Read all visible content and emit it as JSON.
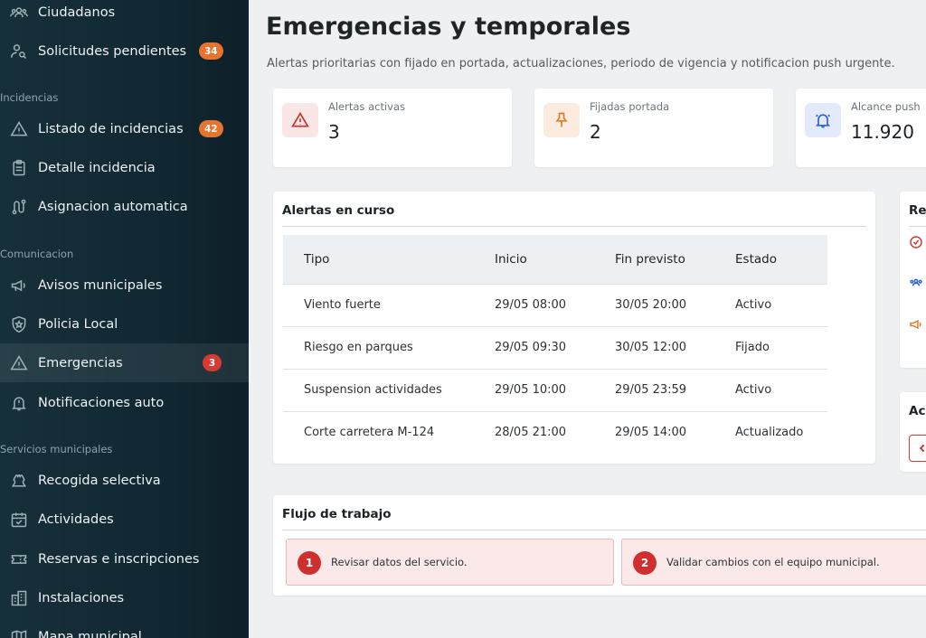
{
  "sidebar": {
    "items": [
      {
        "label": "Ciudadanos"
      },
      {
        "label": "Solicitudes pendientes",
        "badge": "34"
      },
      {
        "label": "Listado de incidencias",
        "badge": "42"
      },
      {
        "label": "Detalle incidencia"
      },
      {
        "label": "Asignacion automatica"
      },
      {
        "label": "Avisos municipales"
      },
      {
        "label": "Policia Local"
      },
      {
        "label": "Emergencias",
        "badge": "3"
      },
      {
        "label": "Notificaciones auto"
      },
      {
        "label": "Recogida selectiva"
      },
      {
        "label": "Actividades"
      },
      {
        "label": "Reservas e inscripciones"
      },
      {
        "label": "Instalaciones"
      },
      {
        "label": "Mapa municipal"
      }
    ],
    "sections": [
      "Incidencias",
      "Comunicacion",
      "Servicios municipales"
    ]
  },
  "header": {
    "title": "Emergencias y temporales",
    "subtitle": "Alertas prioritarias con fijado en portada, actualizaciones, periodo de vigencia y notificacion push urgente."
  },
  "stats": [
    {
      "label": "Alertas activas",
      "value": "3"
    },
    {
      "label": "Fijadas portada",
      "value": "2"
    },
    {
      "label": "Alcance push",
      "value": "11.920"
    }
  ],
  "alerts_panel": {
    "title": "Alertas en curso",
    "columns": [
      "Tipo",
      "Inicio",
      "Fin previsto",
      "Estado"
    ],
    "rows": [
      [
        "Viento fuerte",
        "29/05 08:00",
        "30/05 20:00",
        "Activo"
      ],
      [
        "Riesgo en parques",
        "29/05 09:30",
        "30/05 12:00",
        "Fijado"
      ],
      [
        "Suspension actividades",
        "29/05 10:00",
        "29/05 23:59",
        "Activo"
      ],
      [
        "Corte carretera M-124",
        "28/05 21:00",
        "29/05 14:00",
        "Actualizado"
      ]
    ]
  },
  "right_panels": {
    "top_title": "Re",
    "bottom_title": "Ac"
  },
  "workflow": {
    "title": "Flujo de trabajo",
    "steps": [
      {
        "num": "1",
        "text": "Revisar datos del servicio."
      },
      {
        "num": "2",
        "text": "Validar cambios con el equipo municipal."
      }
    ]
  },
  "colors": {
    "accent_red": "#d73a31",
    "badge_orange": "#e8732e",
    "sidebar_bg": "#122a34"
  }
}
